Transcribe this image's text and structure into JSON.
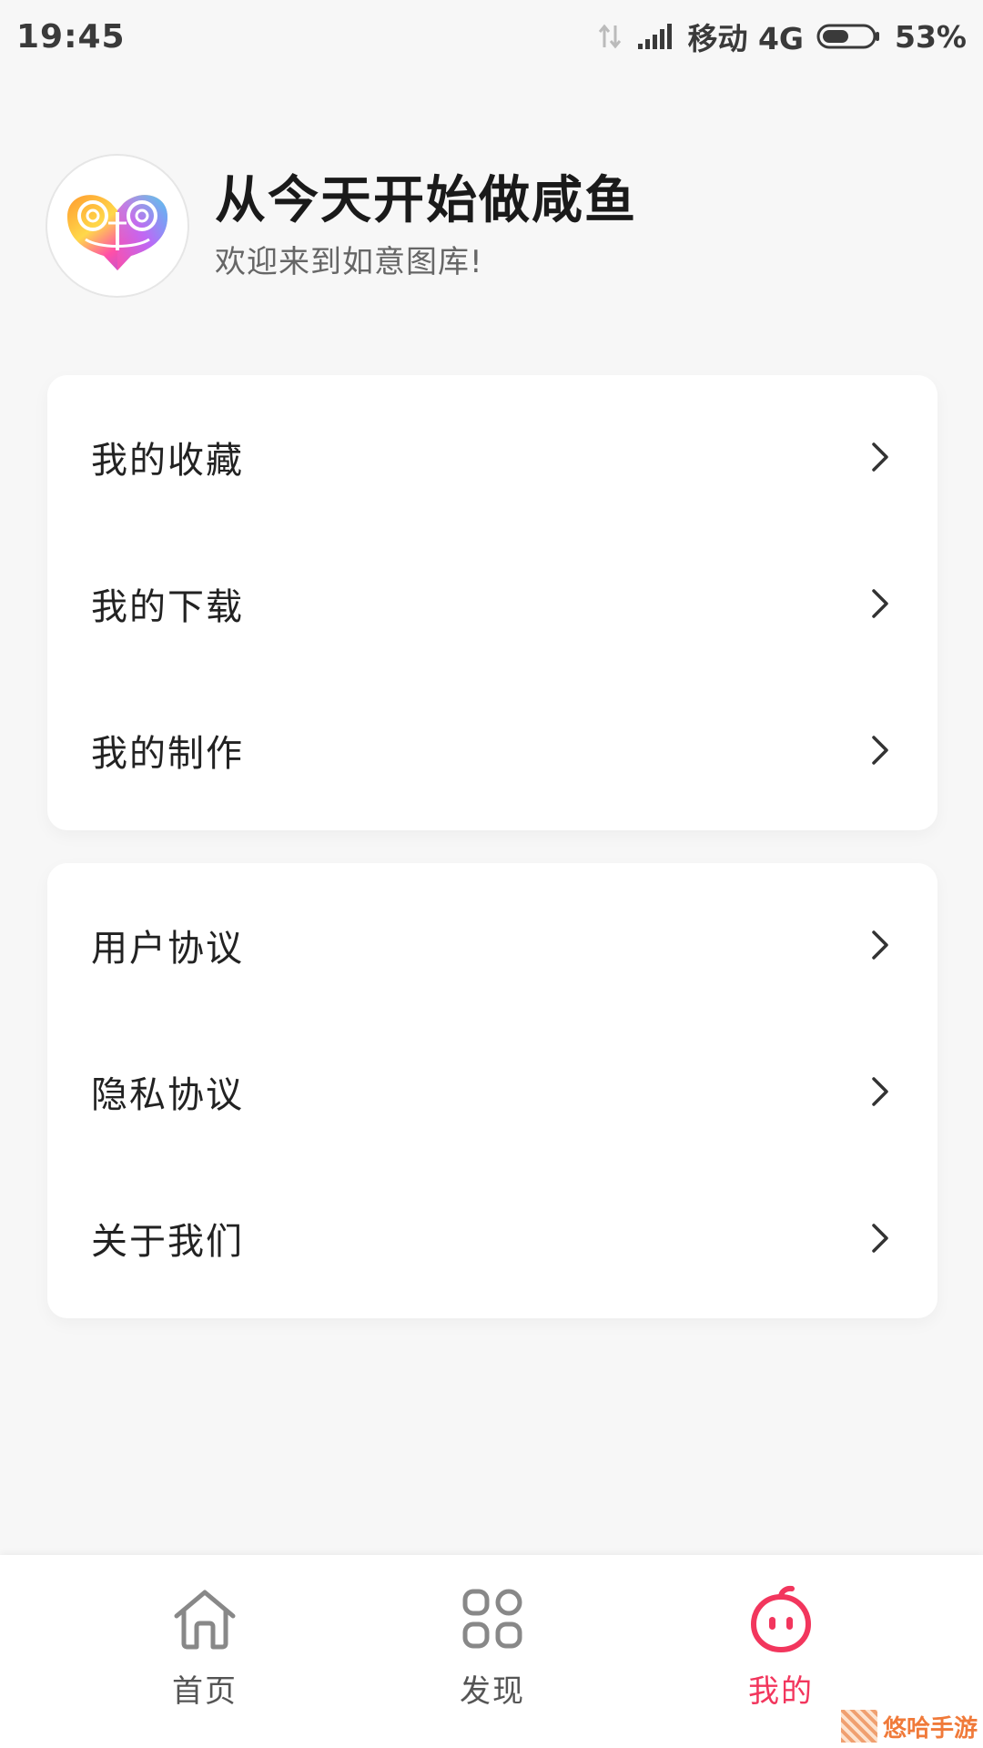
{
  "status_bar": {
    "time": "19:45",
    "carrier": "移动 4G",
    "battery": "53%",
    "battery_level": 0.53
  },
  "profile": {
    "name": "从今天开始做咸鱼",
    "welcome": "欢迎来到如意图库!",
    "avatar_icon": "ruyi-logo-icon"
  },
  "menu_group_1": {
    "items": [
      {
        "label": "我的收藏",
        "icon": "chevron-right-icon"
      },
      {
        "label": "我的下载",
        "icon": "chevron-right-icon"
      },
      {
        "label": "我的制作",
        "icon": "chevron-right-icon"
      }
    ]
  },
  "menu_group_2": {
    "items": [
      {
        "label": "用户协议",
        "icon": "chevron-right-icon"
      },
      {
        "label": "隐私协议",
        "icon": "chevron-right-icon"
      },
      {
        "label": "关于我们",
        "icon": "chevron-right-icon"
      }
    ]
  },
  "bottom_nav": {
    "items": [
      {
        "label": "首页",
        "icon": "home-icon",
        "active": false
      },
      {
        "label": "发现",
        "icon": "grid-icon",
        "active": false
      },
      {
        "label": "我的",
        "icon": "mine-face-icon",
        "active": true
      }
    ]
  },
  "watermark": {
    "text": "悠哈手游"
  },
  "colors": {
    "accent": "#f2365d",
    "background": "#f7f7f7",
    "card": "#ffffff",
    "text_primary": "#222222",
    "text_secondary": "#666666",
    "nav_inactive": "#555555"
  }
}
